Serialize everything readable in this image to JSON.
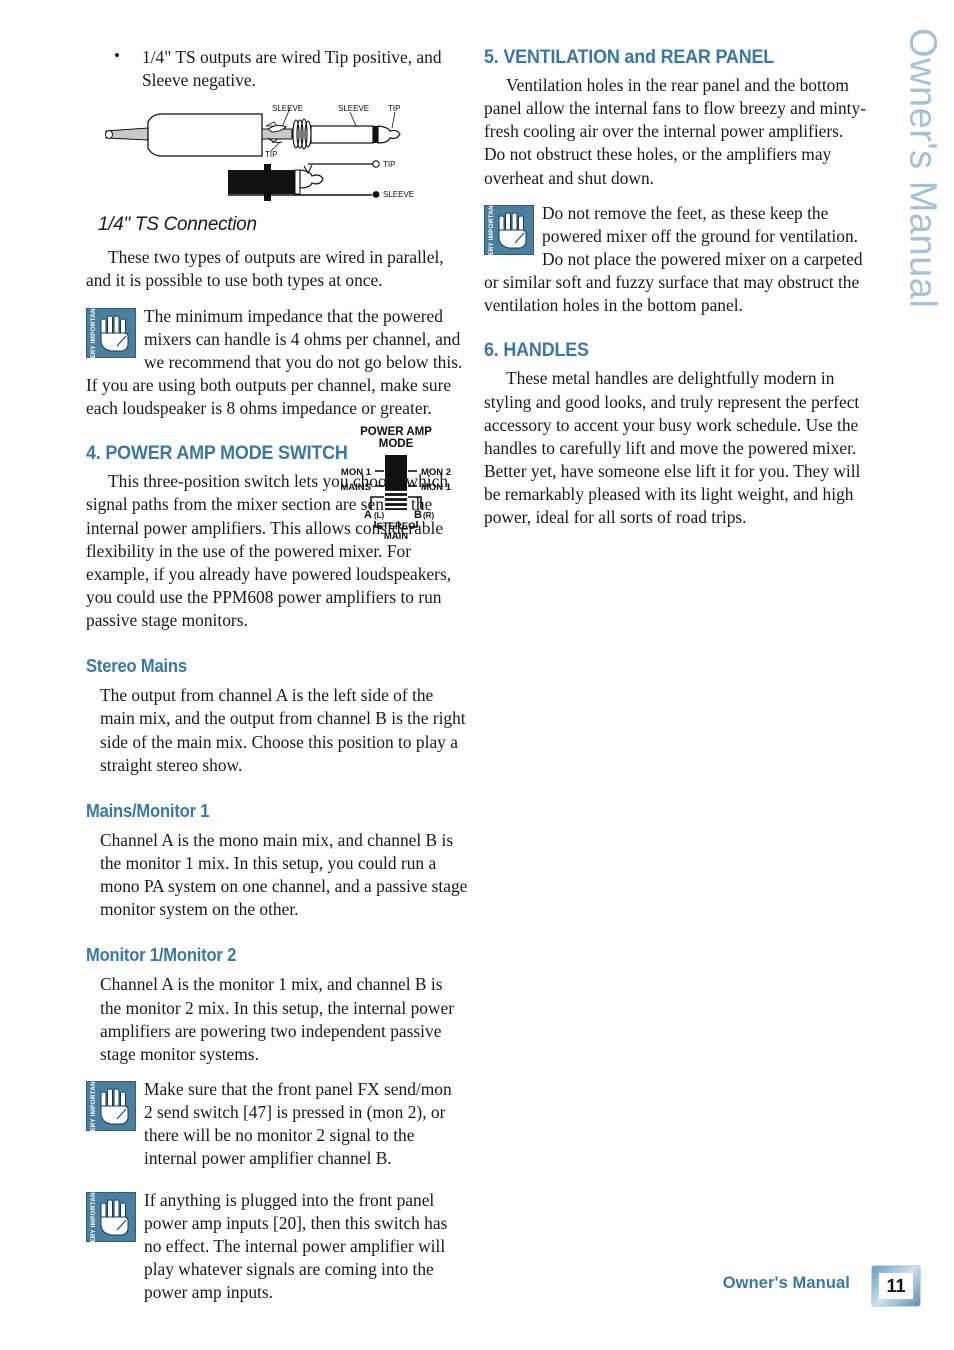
{
  "side_title": "Owner's Manual",
  "left_column": {
    "bullets": [
      "1/4\" TS outputs are wired Tip positive, and Sleeve negative."
    ],
    "jack_figure": {
      "name": "quarter-inch-ts-connection-diagram",
      "labels": {
        "sleeve_upper_left": "SLEEVE",
        "sleeve_upper_right": "SLEEVE",
        "tip_upper_right": "TIP",
        "tip_lower_left": "TIP",
        "tip_right": "TIP",
        "sleeve_right": "SLEEVE"
      }
    },
    "figure_caption": "1/4\" TS Connection",
    "para_parallel": "These two types of outputs are wired in parallel, and it is possible to use both types at once.",
    "callout_impedance": "The minimum impedance that the powered mixers can handle is 4 ohms per channel, and we recommend that you do not go below this. If you are using both outputs per channel, make sure each loudspeaker is 8 ohms impedance or greater.",
    "section4_heading": "4. POWER AMP MODE SWITCH",
    "section4_para": "This three-position switch lets you choose which signal paths from the mixer section are sent to the internal power amplifiers. This allows considerable flexibility in the use of the powered mixer. For example, if you already have powered loudspeakers, you could use the PPM608 power amplifiers to run passive stage monitors.",
    "power_amp_figure": {
      "title_line1": "POWER AMP",
      "title_line2": "MODE",
      "left_top": "MON 1",
      "left_mid": "MAINS",
      "right_top": "MON 2",
      "right_mid": "MON 1",
      "bottom_left_a": "A",
      "bottom_left_a_sub": "(L)",
      "bottom_right_b": "B",
      "bottom_right_b_sub": "(R)",
      "bottom_label1": "STEREO",
      "bottom_label2": "MAIN"
    },
    "sub_stereo_mains": {
      "heading": "Stereo Mains",
      "para": "The output from channel A is the left side of the main mix, and the output from channel B is the right side of the main mix. Choose this position to play a straight stereo show."
    },
    "sub_mains_monitor1": {
      "heading": "Mains/Monitor 1",
      "para": "Channel A is the mono main mix, and channel B is the monitor 1 mix. In this setup, you could run a mono PA system on one channel, and a passive stage monitor system on the other."
    },
    "sub_monitor1_monitor2": {
      "heading": "Monitor 1/Monitor 2",
      "para": "Channel A is the monitor 1 mix, and channel B is the monitor 2 mix. In this setup, the internal power amplifiers are powering two independent passive stage monitor systems.",
      "callout_1": "Make sure that the front panel FX send/mon 2 send switch [47] is pressed in (mon 2), or there will be no monitor 2 signal to the internal power amplifier channel B.",
      "callout_2": "If anything is plugged into the front panel power amp inputs [20], then this switch has no effect. The internal power amplifier will play whatever signals are coming into the power amp inputs."
    }
  },
  "right_column": {
    "section5_heading": "5. VENTILATION and REAR PANEL",
    "section5_para": "Ventilation holes in the rear panel and the bottom panel allow the internal fans to flow breezy and minty-fresh cooling air over the internal power amplifiers. Do not obstruct these holes, or the amplifiers may overheat and shut down.",
    "section5_callout": "Do not remove the feet, as these keep the powered mixer off the ground for ventilation. Do not place the powered mixer on a carpeted or similar soft and fuzzy surface that may obstruct the ventilation holes in the bottom panel.",
    "section6_heading": "6. HANDLES",
    "section6_para": "These metal handles are delightfully modern in styling and good looks, and truly represent the perfect accessory to accent your busy work schedule. Use the handles to carefully lift and move the powered mixer. Better yet, have someone else lift it for you. They will be remarkably pleased with its light weight, and high power, ideal for all sorts of road trips."
  },
  "icons": {
    "very_important_label": "VERY IMPORTANT",
    "very_important_name": "hand-stop-icon"
  },
  "footer": {
    "label": "Owner's Manual",
    "page_number": "11"
  },
  "colors": {
    "heading_blue": "#3a78a3",
    "side_title_blue": "#a8c0d4",
    "callout_icon_blue": "#4a7fa0"
  }
}
